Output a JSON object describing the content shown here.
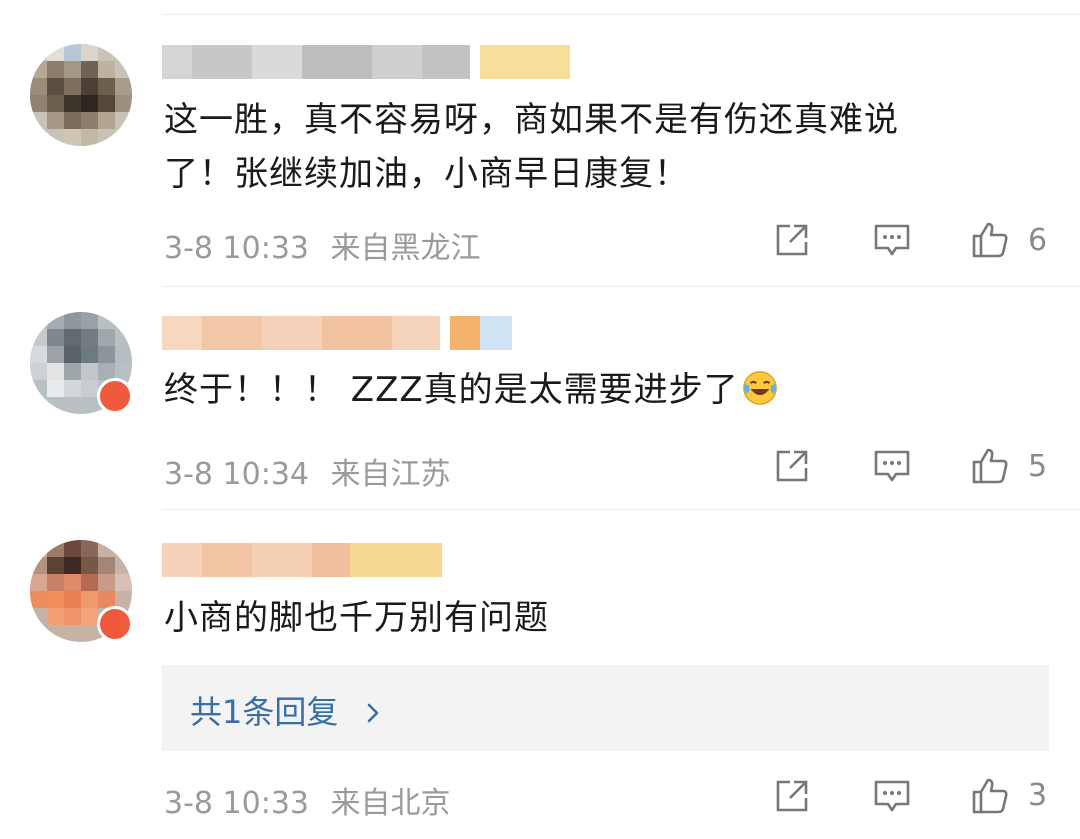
{
  "comments": [
    {
      "text_line1": "这一胜，真不容易呀，商如果不是有伤还真难说",
      "text_line2": "了！张继续加油，小商早日康复！",
      "date": "3-8 10:33",
      "location": "来自黑龙江",
      "likes": "6"
    },
    {
      "text_line1": "终于！！！ ZZZ真的是太需要进步了",
      "date": "3-8 10:34",
      "location": "来自江苏",
      "likes": "5"
    },
    {
      "text_line1": "小商的脚也千万别有问题",
      "reply_label": "共1条回复",
      "date": "3-8 10:33",
      "location": "来自北京",
      "likes": "3"
    }
  ],
  "icons": {
    "share": "share-icon",
    "comment": "comment-icon",
    "like": "thumbs-up-icon",
    "chevron": "chevron-right-icon",
    "emoji": "laughing-tears-emoji"
  },
  "colors": {
    "text": "#1a1a1a",
    "meta": "#9a9a9a",
    "link": "#3a6ea5",
    "reply_bg": "#f3f3f3"
  }
}
